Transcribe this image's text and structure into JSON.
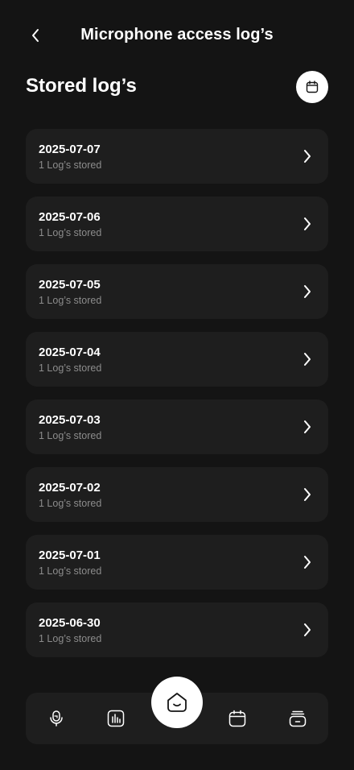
{
  "header": {
    "title": "Microphone access log’s",
    "back_icon": "chevron-left-icon"
  },
  "section": {
    "title": "Stored log’s",
    "calendar_icon": "calendar-icon"
  },
  "logs": [
    {
      "date": "2025-07-07",
      "count": "1 Log’s stored"
    },
    {
      "date": "2025-07-06",
      "count": "1 Log’s stored"
    },
    {
      "date": "2025-07-05",
      "count": "1 Log’s stored"
    },
    {
      "date": "2025-07-04",
      "count": "1 Log’s stored"
    },
    {
      "date": "2025-07-03",
      "count": "1 Log’s stored"
    },
    {
      "date": "2025-07-02",
      "count": "1 Log’s stored"
    },
    {
      "date": "2025-07-01",
      "count": "1 Log’s stored"
    },
    {
      "date": "2025-06-30",
      "count": "1 Log’s stored"
    }
  ],
  "nav": {
    "items": [
      "microphone-icon",
      "chart-icon",
      "home-icon",
      "calendar-icon",
      "storage-icon"
    ],
    "active": "home-icon"
  },
  "colors": {
    "background": "#141414",
    "card": "#1e1e1e",
    "text": "#ffffff",
    "muted": "#8c8c8c",
    "accent": "#ffffff"
  }
}
